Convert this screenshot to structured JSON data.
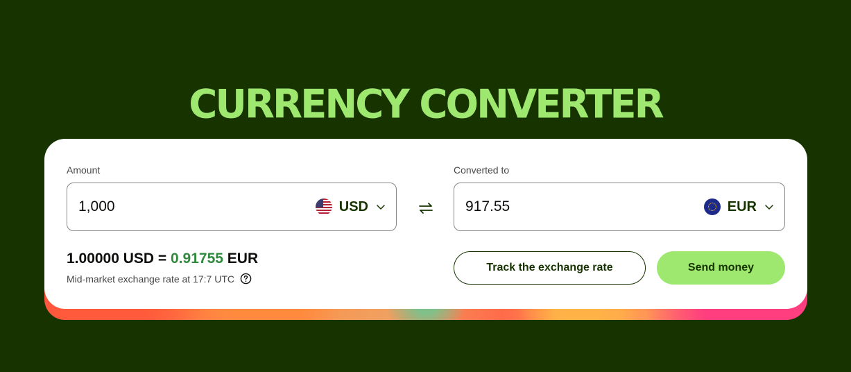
{
  "page": {
    "title": "CURRENCY CONVERTER"
  },
  "converter": {
    "amount": {
      "label": "Amount",
      "value": "1,000",
      "currency": "USD",
      "flag_icon": "us-flag-icon"
    },
    "converted": {
      "label": "Converted to",
      "value": "917.55",
      "currency": "EUR",
      "flag_icon": "eu-flag-icon"
    },
    "swap_icon": "swap-arrows-icon",
    "rate": {
      "prefix": "1.00000 USD = ",
      "value": "0.91755",
      "suffix": " EUR",
      "note": "Mid-market exchange rate at 17:7 UTC"
    },
    "buttons": {
      "track": "Track the exchange rate",
      "send": "Send money"
    }
  },
  "colors": {
    "background": "#163300",
    "accent": "#9fe870",
    "rate_highlight": "#2f8a3e",
    "text": "#0e0f0c"
  }
}
